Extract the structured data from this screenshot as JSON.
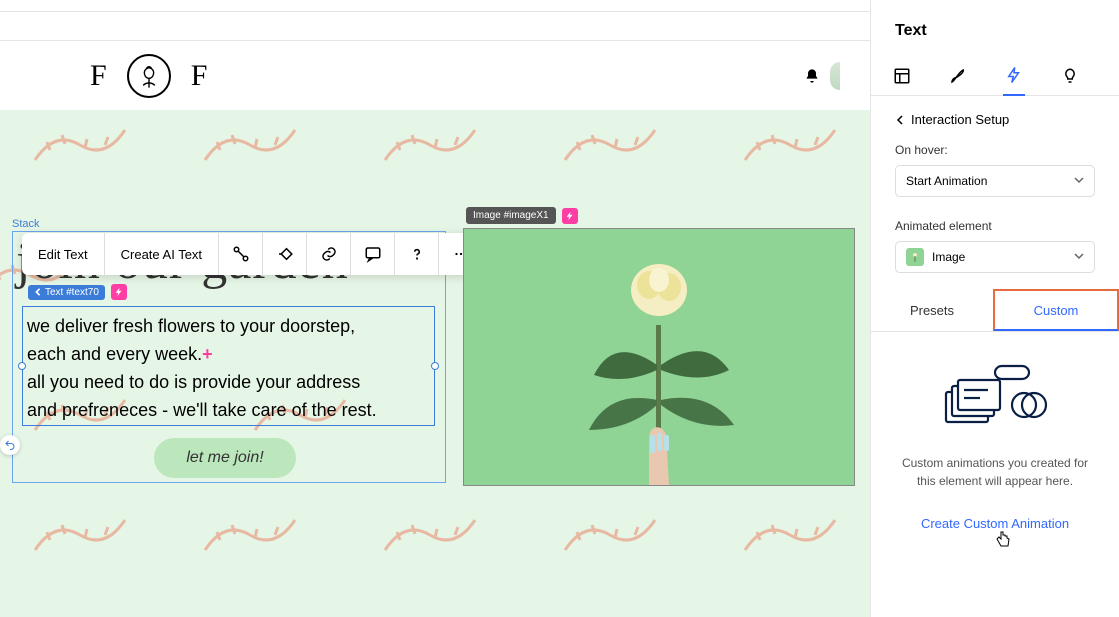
{
  "header": {
    "logo_letter": "F"
  },
  "canvas": {
    "stack_label": "Stack",
    "heading": "join our garden",
    "text_chip": "Text #text70",
    "body_line1": "we deliver fresh flowers to your doorstep,",
    "body_line2": "each and every week.",
    "body_line3": "all you need to do is provide your address",
    "body_line4": "and prefreneces - we'll take care of the rest.",
    "join_button": "let me join!",
    "image_chip": "Image #imageX1"
  },
  "toolbar": {
    "edit_text": "Edit Text",
    "create_ai": "Create AI Text"
  },
  "panel": {
    "title": "Text",
    "setup": "Interaction Setup",
    "on_hover_label": "On hover:",
    "on_hover_value": "Start Animation",
    "animated_label": "Animated element",
    "animated_value": "Image",
    "tab_presets": "Presets",
    "tab_custom": "Custom",
    "empty_desc": "Custom animations you created for this element will appear here.",
    "create_link": "Create Custom Animation"
  }
}
